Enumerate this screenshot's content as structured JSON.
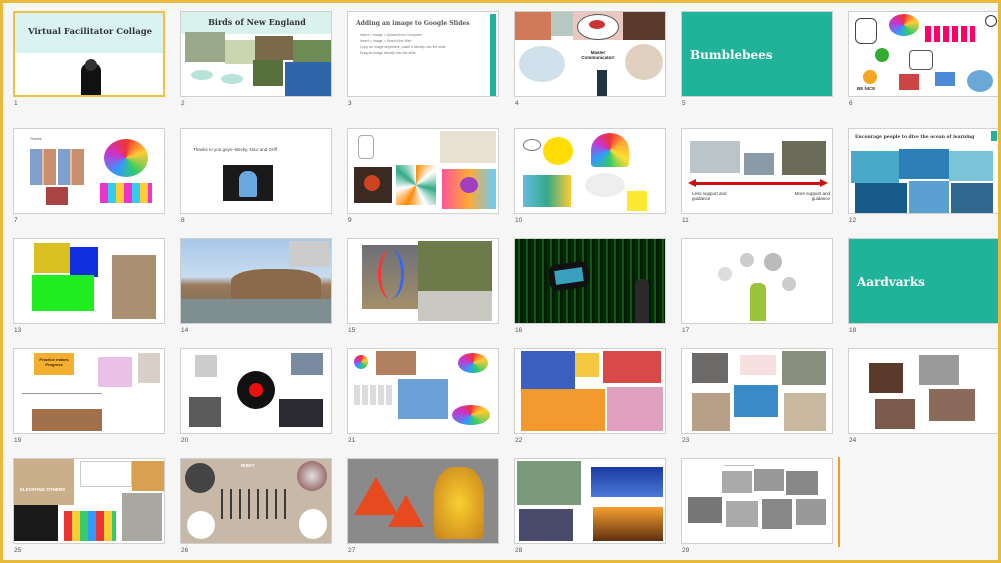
{
  "slides": [
    {
      "number": "1",
      "title": "Virtual Facilitator Collage"
    },
    {
      "number": "2",
      "title": "Birds of New England"
    },
    {
      "number": "3",
      "title": "Adding an image to Google Slides",
      "bullets": [
        "Insert > Image > Upload from Computer",
        "Insert > Image > Search the Web",
        "Copy an image anywhere, paste it directly into the slide",
        "Drag an image directly into the slide"
      ]
    },
    {
      "number": "4",
      "caption": "Master Communicator!"
    },
    {
      "number": "5",
      "title": "Bumblebees"
    },
    {
      "number": "6",
      "caption": "BE NICE"
    },
    {
      "number": "7",
      "caption": "Thanks"
    },
    {
      "number": "8",
      "title": "Thanks to you guys--Becky, Nico and Griff"
    },
    {
      "number": "9"
    },
    {
      "number": "10"
    },
    {
      "number": "11",
      "left_label": "Less support and guidance",
      "right_label": "More support and guidance"
    },
    {
      "number": "12",
      "title": "Encourage people to dive the ocean of learning"
    },
    {
      "number": "13"
    },
    {
      "number": "14"
    },
    {
      "number": "15"
    },
    {
      "number": "16"
    },
    {
      "number": "17"
    },
    {
      "number": "18",
      "title": "Aardvarks"
    },
    {
      "number": "19",
      "caption": "Practice makes Progress"
    },
    {
      "number": "20"
    },
    {
      "number": "21"
    },
    {
      "number": "22"
    },
    {
      "number": "23"
    },
    {
      "number": "24"
    },
    {
      "number": "25",
      "caption": "ELEVATING OTHERS"
    },
    {
      "number": "26",
      "caption": "RISKY"
    },
    {
      "number": "27"
    },
    {
      "number": "28"
    },
    {
      "number": "29"
    }
  ],
  "colors": {
    "frame": "#e8b93a",
    "teal": "#21b39a",
    "red": "#cc1111"
  }
}
